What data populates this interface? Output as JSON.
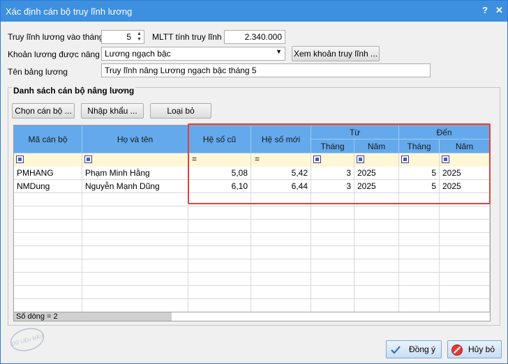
{
  "window": {
    "title": "Xác định cán bộ truy lĩnh lương",
    "help": "?",
    "close": "✕"
  },
  "form": {
    "month_label": "Truy lĩnh lương vào tháng",
    "month_value": "5",
    "mltt_label": "MLTT tính truy lĩnh",
    "mltt_value": "2.340.000",
    "salary_label": "Khoản lương được nâng",
    "salary_value": "Lương ngạch bậc",
    "view_button": "Xem khoản truy lĩnh ...",
    "sheet_label": "Tên bảng lương",
    "sheet_value": "Truy lĩnh nâng Lương ngạch bậc tháng 5"
  },
  "group": {
    "title": "Danh sách cán bộ nâng lương",
    "select_button": "Chọn cán bộ ...",
    "import_button": "Nhập khẩu ...",
    "remove_button": "Loại bỏ"
  },
  "grid": {
    "headers": {
      "code": "Mã cán bộ",
      "name": "Họ và tên",
      "old_coef": "Hệ số cũ",
      "new_coef": "Hệ số mới",
      "from": "Từ",
      "to": "Đến",
      "from_month": "Tháng",
      "from_year": "Năm",
      "to_month": "Tháng",
      "to_year": "Năm"
    },
    "filter_eq": "=",
    "rows": [
      {
        "code": "PMHANG",
        "name": "Phạm Minh Hằng",
        "old": "5,08",
        "new": "5,42",
        "fm": "3",
        "fy": "2025",
        "tm": "5",
        "ty": "2025"
      },
      {
        "code": "NMDung",
        "name": "Nguyễn Mạnh Dũng",
        "old": "6,10",
        "new": "6,44",
        "fm": "3",
        "fy": "2025",
        "tm": "5",
        "ty": "2025"
      }
    ],
    "status": "Số dòng = 2"
  },
  "footer": {
    "ok": "Đồng ý",
    "cancel": "Hủy bỏ",
    "stamp": "DỮ LIỆU MẪU"
  },
  "colors": {
    "title_bar": "#3d8fe0",
    "header": "#63a9ec",
    "highlight": "#e0403c",
    "filter_row": "#fff7d6"
  }
}
